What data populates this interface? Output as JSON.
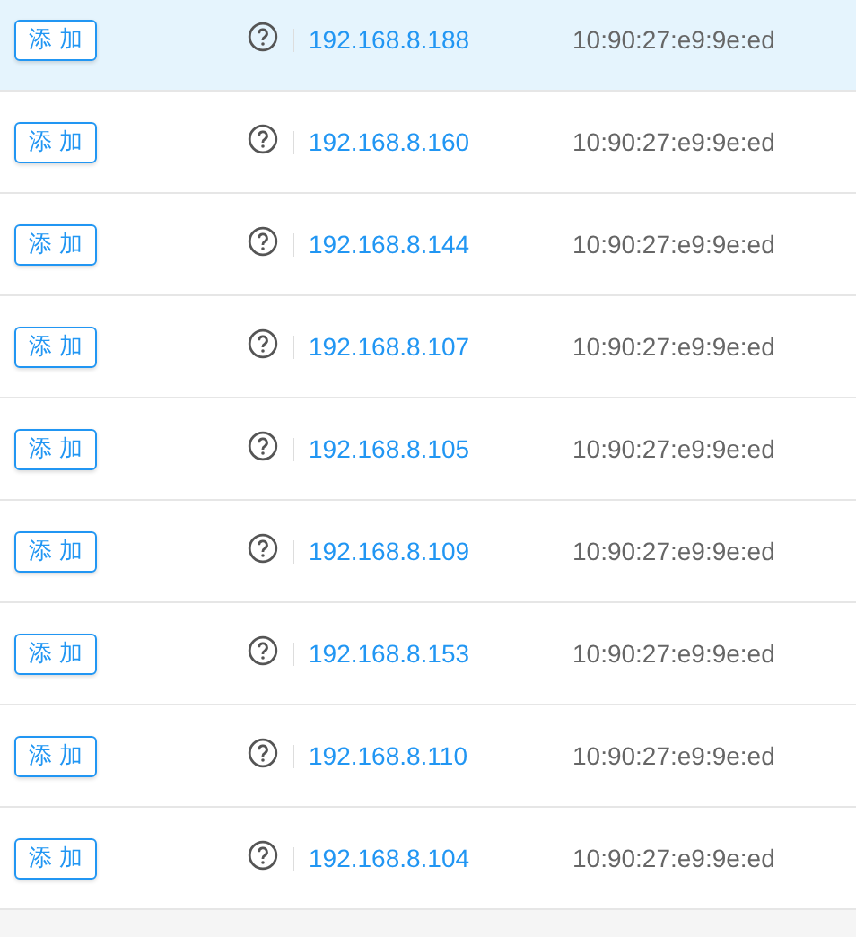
{
  "rows": [
    {
      "button": "添 加",
      "ip": "192.168.8.188",
      "mac": "10:90:27:e9:9e:ed",
      "selected": true
    },
    {
      "button": "添 加",
      "ip": "192.168.8.160",
      "mac": "10:90:27:e9:9e:ed",
      "selected": false
    },
    {
      "button": "添 加",
      "ip": "192.168.8.144",
      "mac": "10:90:27:e9:9e:ed",
      "selected": false
    },
    {
      "button": "添 加",
      "ip": "192.168.8.107",
      "mac": "10:90:27:e9:9e:ed",
      "selected": false
    },
    {
      "button": "添 加",
      "ip": "192.168.8.105",
      "mac": "10:90:27:e9:9e:ed",
      "selected": false
    },
    {
      "button": "添 加",
      "ip": "192.168.8.109",
      "mac": "10:90:27:e9:9e:ed",
      "selected": false
    },
    {
      "button": "添 加",
      "ip": "192.168.8.153",
      "mac": "10:90:27:e9:9e:ed",
      "selected": false
    },
    {
      "button": "添 加",
      "ip": "192.168.8.110",
      "mac": "10:90:27:e9:9e:ed",
      "selected": false
    },
    {
      "button": "添 加",
      "ip": "192.168.8.104",
      "mac": "10:90:27:e9:9e:ed",
      "selected": false
    }
  ]
}
